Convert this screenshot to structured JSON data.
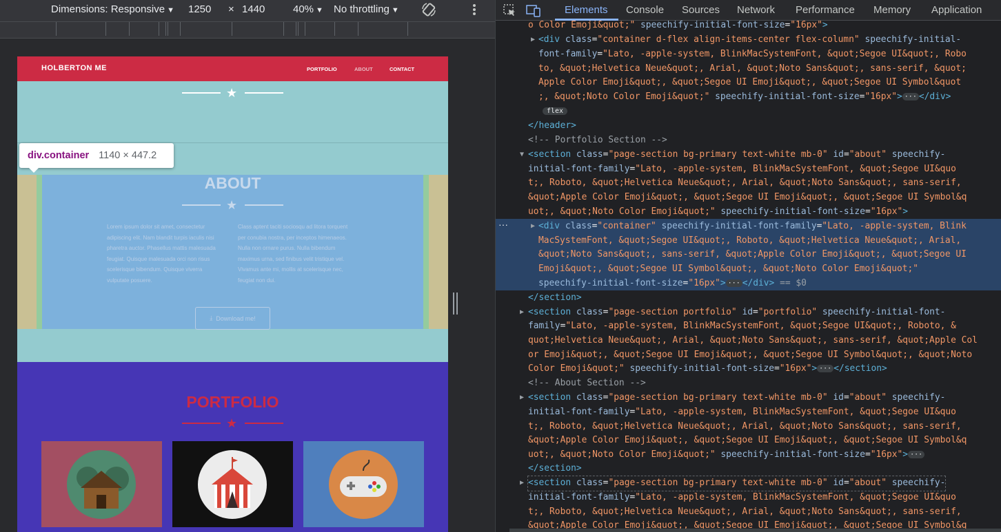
{
  "device_toolbar": {
    "dimensions_label": "Dimensions: Responsive",
    "width": "1250",
    "times": "×",
    "height": "1440",
    "zoom": "40%",
    "throttling": "No throttling"
  },
  "site": {
    "brand": "HOLBERTON ME",
    "nav": [
      "PORTFOLIO",
      "ABOUT",
      "CONTACT"
    ],
    "about_title": "ABOUT",
    "about_left": "Lorem ipsum dolor sit amet, consectetur adipiscing elit. Nam blandit turpis iaculis nisi pharetra auctor. Phasellus mattis malesuada feugiat. Quisque malesuada orci non risus scelerisque bibendum. Quisque viverra vulputate posuere.",
    "about_right": "Class aptent taciti sociosqu ad litora torquent per conubia nostra, per inceptos himenaeos. Nulla non ornare purus. Nulla bibendum maximus urna, sed finibus velit tristique vel. Vivamus ante mi, mollis at scelerisque nec, feugiat non dui.",
    "download_label": "Download me!",
    "portfolio_title": "PORTFOLIO"
  },
  "tooltip": {
    "tag": "div.container",
    "dims": "1140 × 447.2"
  },
  "devtools": {
    "tabs": [
      "Elements",
      "Console",
      "Sources",
      "Network",
      "Performance",
      "Memory",
      "Application"
    ],
    "selected_suffix": "== $0"
  },
  "colors": {
    "navbar": "#cc2b44",
    "masthead": "#94cbcf",
    "portfolio_bg": "#4636b5",
    "devtools_bg": "#202124",
    "selected_row": "#2a4467"
  }
}
